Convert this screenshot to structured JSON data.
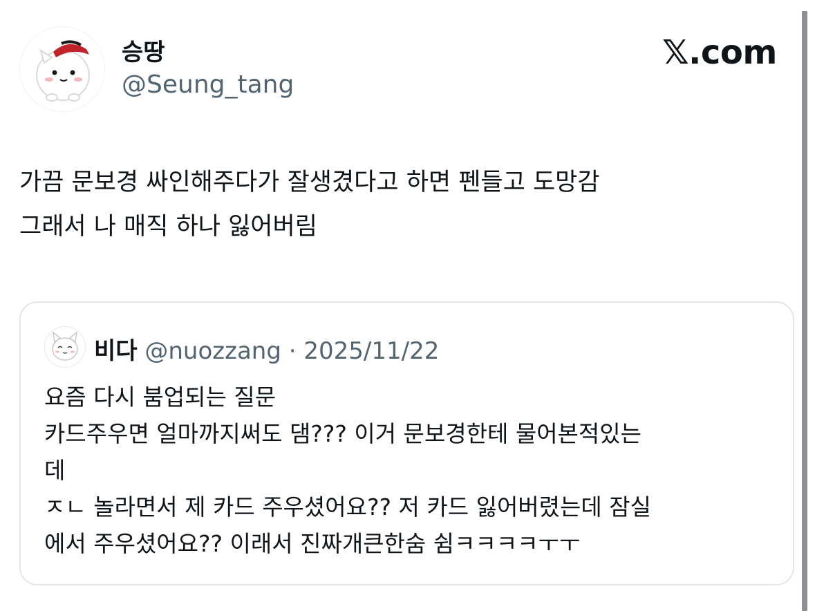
{
  "author": {
    "display_name": "승땅",
    "handle": "@Seung_tang"
  },
  "brand": {
    "label": "𝕏.com"
  },
  "tweet": {
    "lines": [
      "가끔 문보경 싸인해주다가 잘생겼다고 하면 펜들고 도망감",
      "그래서 나 매직 하나 잃어버림"
    ]
  },
  "quote": {
    "display_name": "비다",
    "handle": "@nuozzang",
    "separator": "·",
    "date": "2025/11/22",
    "lines": [
      "요즘 다시 붐업되는 질문",
      "카드주우면 얼마까지써도 댐??? 이거 문보경한테 물어본적있는",
      "데",
      "ㅈㄴ 놀라면서 제 카드 주우셨어요?? 저 카드 잃어버렸는데 잠실",
      "에서 주우셨어요?? 이래서 진짜개큰한숨 쉼ㅋㅋㅋㅋㅜㅜ"
    ]
  },
  "icons": {
    "author_avatar": "white-cat-with-red-cap-avatar",
    "quote_avatar": "white-cat-avatar"
  },
  "colors": {
    "primary_text": "#0f1419",
    "secondary_text": "#536471",
    "card_border": "#e1e6ea"
  }
}
